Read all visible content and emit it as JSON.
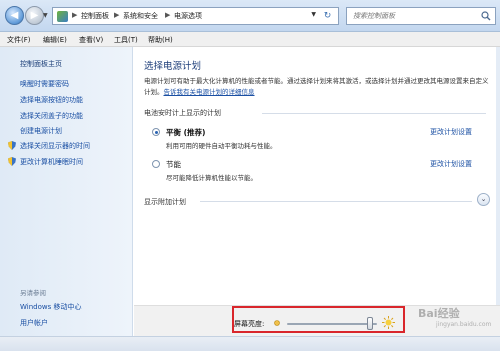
{
  "address_bar": {
    "breadcrumbs": [
      "控制面板",
      "系统和安全",
      "电源选项"
    ],
    "search_placeholder": "搜索控制面板",
    "back_arrow": "◀",
    "forward_arrow": "▶",
    "dropdown_arrow": "▼",
    "crumb_separator": "▶",
    "refresh_glyph": "↻"
  },
  "menu": {
    "items": [
      "文件(F)",
      "编辑(E)",
      "查看(V)",
      "工具(T)",
      "帮助(H)"
    ]
  },
  "help_button": "?",
  "sidebar": {
    "home": "控制面板主页",
    "links": [
      "唤醒时需要密码",
      "选择电源按钮的功能",
      "选择关闭盖子的功能",
      "创建电源计划",
      "选择关闭显示器的时间",
      "更改计算机睡眠时间"
    ],
    "see_also_title": "另请参阅",
    "see_also": [
      "Windows 移动中心",
      "用户帐户"
    ]
  },
  "main": {
    "title": "选择电源计划",
    "description": "电源计划可有助于最大化计算机的性能或者节能。通过选择计划来将其激活，或选择计划并通过更改其电源设置来自定义计划。",
    "description_link": "告诉我有关电源计划的详细信息",
    "section_label": "电池安时计上显示的计划",
    "plans": [
      {
        "name": "平衡 (推荐)",
        "description": "利用可用的硬件自动平衡功耗与性能。",
        "link": "更改计划设置",
        "selected": true
      },
      {
        "name": "节能",
        "description": "尽可能降低计算机性能以节能。",
        "link": "更改计划设置",
        "selected": false
      }
    ],
    "extra_plans_label": "显示附加计划",
    "expand_glyph": "⌄"
  },
  "brightness": {
    "label": "屏幕亮度:",
    "level_percent": 92
  },
  "watermark": {
    "text": "Bai经验",
    "sub": "jingyan.baidu.com"
  },
  "colors": {
    "link": "#1a4fa3",
    "title": "#1e3e7a",
    "highlight": "#d9262b",
    "sidebar_bg": "#dfeaf6"
  }
}
